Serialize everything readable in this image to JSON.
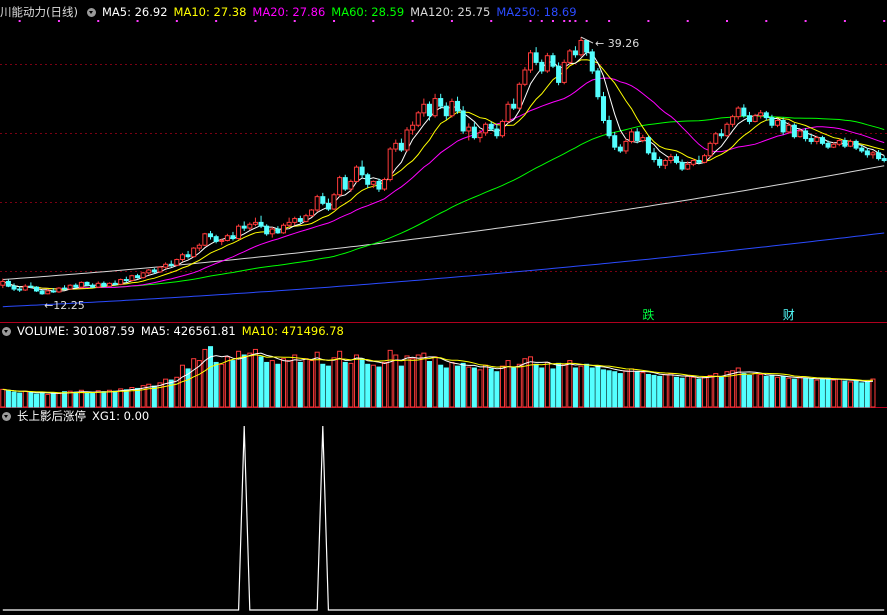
{
  "header_price": {
    "stock_name": "川能动力",
    "period": "(日线)",
    "items": [
      {
        "label": "MA5: 26.92",
        "color": "#ffffff"
      },
      {
        "label": "MA10: 27.38",
        "color": "#ffff00"
      },
      {
        "label": "MA20: 27.86",
        "color": "#ff00ff"
      },
      {
        "label": "MA60: 28.59",
        "color": "#00ff00"
      },
      {
        "label": "MA120: 25.75",
        "color": "#d8d8d8"
      },
      {
        "label": "MA250: 18.69",
        "color": "#2b4bff"
      }
    ]
  },
  "header_volume": {
    "items": [
      {
        "label": "VOLUME: 301087.59",
        "color": "#ffffff"
      },
      {
        "label": "MA5: 426561.81",
        "color": "#ffffff"
      },
      {
        "label": "MA10: 471496.78",
        "color": "#ffff00"
      }
    ]
  },
  "header_indicator": {
    "items": [
      {
        "label": "长上影后涨停",
        "color": "#ffffff"
      },
      {
        "label": "XG1: 0.00",
        "color": "#ffffff"
      }
    ]
  },
  "colors": {
    "up": "#ff3b3b",
    "down": "#54ffff",
    "divider": "#b0001e",
    "ma5": "#ffffff",
    "ma10": "#ffff00",
    "ma20": "#ff00ff",
    "ma60": "#00ff00",
    "ma120": "#d8d8d8",
    "ma250": "#2b4bff"
  },
  "chart_data": {
    "type": "candlestick",
    "y_range": [
      10.6,
      40.0
    ],
    "high_label": "39.26",
    "low_label": "12.25",
    "markers": [
      {
        "text": "跌",
        "index": 115
      },
      {
        "text": "财",
        "index": 140
      }
    ],
    "ohlc": [
      [
        13.2,
        13.9,
        12.9,
        13.6
      ],
      [
        13.6,
        13.8,
        13.0,
        13.1
      ],
      [
        13.1,
        13.4,
        12.6,
        12.8
      ],
      [
        12.8,
        13.1,
        12.5,
        12.7
      ],
      [
        12.7,
        13.3,
        12.6,
        13.1
      ],
      [
        13.1,
        13.5,
        12.9,
        13.0
      ],
      [
        13.0,
        13.1,
        12.5,
        12.6
      ],
      [
        12.6,
        12.7,
        12.2,
        12.3
      ],
      [
        12.3,
        12.8,
        12.25,
        12.6
      ],
      [
        12.6,
        12.9,
        12.4,
        12.5
      ],
      [
        12.5,
        13.0,
        12.4,
        12.9
      ],
      [
        12.9,
        13.2,
        12.7,
        12.8
      ],
      [
        12.8,
        13.3,
        12.7,
        13.2
      ],
      [
        13.2,
        13.4,
        12.9,
        13.0
      ],
      [
        13.0,
        13.6,
        12.9,
        13.5
      ],
      [
        13.5,
        13.6,
        13.1,
        13.2
      ],
      [
        13.2,
        13.4,
        12.9,
        13.0
      ],
      [
        13.0,
        13.6,
        12.9,
        13.4
      ],
      [
        13.4,
        13.6,
        13.0,
        13.1
      ],
      [
        13.1,
        13.5,
        13.0,
        13.4
      ],
      [
        13.4,
        13.7,
        13.2,
        13.3
      ],
      [
        13.3,
        13.9,
        13.2,
        13.8
      ],
      [
        13.8,
        14.1,
        13.5,
        13.7
      ],
      [
        13.7,
        14.3,
        13.6,
        14.2
      ],
      [
        14.2,
        14.4,
        13.9,
        14.0
      ],
      [
        14.0,
        14.6,
        13.9,
        14.5
      ],
      [
        14.5,
        14.9,
        14.3,
        14.8
      ],
      [
        14.8,
        15.0,
        14.4,
        14.6
      ],
      [
        14.6,
        15.2,
        14.5,
        15.1
      ],
      [
        15.1,
        15.6,
        14.9,
        15.4
      ],
      [
        15.4,
        15.8,
        15.1,
        15.3
      ],
      [
        15.3,
        16.0,
        15.2,
        15.9
      ],
      [
        15.9,
        16.6,
        15.7,
        16.4
      ],
      [
        16.4,
        16.8,
        16.0,
        16.2
      ],
      [
        16.2,
        17.2,
        16.1,
        17.1
      ],
      [
        17.1,
        17.6,
        16.8,
        17.4
      ],
      [
        17.4,
        18.7,
        17.3,
        18.6
      ],
      [
        18.6,
        18.9,
        18.0,
        18.3
      ],
      [
        18.3,
        18.5,
        17.6,
        17.8
      ],
      [
        17.8,
        18.1,
        17.4,
        17.9
      ],
      [
        17.9,
        18.6,
        17.8,
        18.4
      ],
      [
        18.4,
        18.8,
        17.9,
        18.1
      ],
      [
        18.1,
        19.6,
        18.0,
        19.4
      ],
      [
        19.4,
        19.9,
        18.9,
        19.2
      ],
      [
        19.2,
        19.8,
        19.0,
        19.6
      ],
      [
        19.6,
        20.3,
        19.4,
        19.8
      ],
      [
        19.8,
        20.5,
        19.2,
        19.4
      ],
      [
        19.4,
        19.6,
        18.4,
        18.6
      ],
      [
        18.6,
        19.3,
        18.2,
        19.1
      ],
      [
        19.1,
        19.4,
        18.6,
        18.7
      ],
      [
        18.7,
        19.7,
        18.6,
        19.5
      ],
      [
        19.5,
        20.3,
        19.3,
        19.8
      ],
      [
        19.8,
        20.4,
        19.5,
        20.2
      ],
      [
        20.2,
        20.5,
        19.7,
        19.9
      ],
      [
        19.9,
        20.7,
        19.8,
        20.5
      ],
      [
        20.5,
        21.2,
        20.4,
        21.1
      ],
      [
        21.1,
        22.7,
        20.9,
        22.5
      ],
      [
        22.5,
        22.9,
        21.6,
        21.8
      ],
      [
        21.8,
        22.3,
        21.0,
        21.2
      ],
      [
        21.2,
        22.9,
        21.1,
        22.7
      ],
      [
        22.7,
        24.7,
        22.5,
        24.5
      ],
      [
        24.5,
        24.8,
        23.1,
        23.3
      ],
      [
        23.3,
        24.3,
        23.0,
        24.1
      ],
      [
        24.1,
        25.8,
        24.0,
        25.6
      ],
      [
        25.6,
        26.3,
        24.5,
        24.8
      ],
      [
        24.8,
        25.0,
        23.4,
        23.8
      ],
      [
        23.8,
        24.2,
        23.4,
        24.1
      ],
      [
        24.1,
        24.4,
        23.0,
        23.3
      ],
      [
        23.3,
        24.5,
        23.1,
        24.3
      ],
      [
        24.3,
        27.7,
        24.1,
        27.5
      ],
      [
        27.5,
        28.5,
        27.2,
        28.1
      ],
      [
        28.1,
        28.6,
        27.2,
        27.4
      ],
      [
        27.4,
        29.8,
        27.2,
        29.5
      ],
      [
        29.5,
        30.4,
        29.0,
        30.0
      ],
      [
        30.0,
        31.5,
        29.8,
        31.3
      ],
      [
        31.3,
        32.8,
        30.9,
        32.2
      ],
      [
        32.2,
        32.5,
        30.5,
        31.0
      ],
      [
        31.0,
        33.3,
        30.8,
        32.8
      ],
      [
        32.8,
        33.3,
        31.7,
        32.0
      ],
      [
        32.0,
        32.4,
        30.6,
        31.0
      ],
      [
        31.0,
        32.8,
        30.8,
        32.5
      ],
      [
        32.5,
        33.0,
        31.2,
        31.5
      ],
      [
        31.5,
        32.0,
        29.1,
        29.4
      ],
      [
        29.4,
        30.2,
        28.4,
        29.8
      ],
      [
        29.8,
        30.3,
        28.5,
        28.7
      ],
      [
        28.7,
        29.5,
        28.2,
        29.2
      ],
      [
        29.2,
        30.3,
        28.9,
        30.1
      ],
      [
        30.1,
        30.4,
        29.4,
        29.6
      ],
      [
        29.6,
        30.1,
        28.6,
        28.9
      ],
      [
        28.9,
        30.6,
        28.7,
        30.4
      ],
      [
        30.4,
        32.5,
        30.2,
        32.2
      ],
      [
        32.2,
        32.8,
        31.6,
        31.8
      ],
      [
        31.8,
        34.5,
        31.6,
        34.3
      ],
      [
        34.3,
        36.1,
        34.1,
        35.8
      ],
      [
        35.8,
        37.9,
        35.5,
        37.6
      ],
      [
        37.6,
        38.2,
        36.3,
        36.6
      ],
      [
        36.6,
        36.9,
        35.4,
        35.7
      ],
      [
        35.7,
        37.6,
        35.5,
        37.3
      ],
      [
        37.3,
        37.6,
        36.0,
        36.2
      ],
      [
        36.2,
        36.6,
        34.2,
        34.5
      ],
      [
        34.5,
        36.9,
        34.3,
        36.6
      ],
      [
        36.6,
        38.0,
        36.4,
        37.8
      ],
      [
        37.8,
        38.3,
        37.1,
        37.4
      ],
      [
        37.4,
        39.26,
        37.2,
        38.9
      ],
      [
        38.9,
        39.0,
        37.3,
        37.7
      ],
      [
        37.7,
        38.0,
        35.4,
        35.7
      ],
      [
        35.7,
        36.0,
        32.7,
        33.0
      ],
      [
        33.0,
        33.5,
        30.2,
        30.5
      ],
      [
        30.5,
        31.0,
        28.6,
        28.9
      ],
      [
        28.9,
        29.3,
        27.4,
        27.7
      ],
      [
        27.7,
        28.0,
        27.1,
        27.3
      ],
      [
        27.3,
        28.6,
        27.0,
        28.3
      ],
      [
        28.3,
        29.6,
        28.1,
        29.3
      ],
      [
        29.3,
        29.7,
        28.1,
        28.4
      ],
      [
        28.4,
        29.0,
        28.2,
        28.7
      ],
      [
        28.7,
        28.9,
        26.9,
        27.1
      ],
      [
        27.1,
        27.6,
        26.1,
        26.4
      ],
      [
        26.4,
        26.7,
        25.5,
        25.8
      ],
      [
        25.8,
        26.5,
        25.4,
        26.3
      ],
      [
        26.3,
        27.0,
        26.0,
        26.7
      ],
      [
        26.7,
        27.0,
        25.9,
        26.1
      ],
      [
        26.1,
        26.4,
        25.2,
        25.4
      ],
      [
        25.4,
        26.2,
        25.3,
        25.9
      ],
      [
        25.9,
        26.5,
        25.7,
        26.3
      ],
      [
        26.3,
        26.8,
        25.9,
        26.1
      ],
      [
        26.1,
        27.0,
        26.0,
        26.8
      ],
      [
        26.8,
        28.3,
        26.6,
        28.1
      ],
      [
        28.1,
        29.3,
        27.9,
        29.1
      ],
      [
        29.1,
        29.6,
        28.6,
        28.9
      ],
      [
        28.9,
        30.3,
        28.8,
        30.1
      ],
      [
        30.1,
        31.1,
        29.8,
        30.9
      ],
      [
        30.9,
        32.0,
        30.6,
        31.8
      ],
      [
        31.8,
        32.2,
        30.8,
        31.0
      ],
      [
        31.0,
        31.4,
        30.1,
        30.4
      ],
      [
        30.4,
        31.2,
        30.3,
        31.0
      ],
      [
        31.0,
        31.6,
        30.7,
        31.3
      ],
      [
        31.3,
        31.5,
        30.5,
        30.8
      ],
      [
        30.8,
        31.1,
        29.7,
        30.0
      ],
      [
        30.0,
        30.7,
        29.8,
        30.5
      ],
      [
        30.5,
        30.8,
        29.0,
        29.3
      ],
      [
        29.3,
        30.3,
        29.1,
        30.0
      ],
      [
        30.0,
        30.2,
        28.6,
        28.8
      ],
      [
        28.8,
        29.6,
        28.7,
        29.4
      ],
      [
        29.4,
        29.7,
        28.3,
        28.6
      ],
      [
        28.6,
        29.1,
        28.0,
        28.3
      ],
      [
        28.3,
        28.9,
        28.0,
        28.7
      ],
      [
        28.7,
        28.9,
        27.9,
        28.1
      ],
      [
        28.1,
        28.4,
        27.5,
        27.7
      ],
      [
        27.7,
        28.2,
        27.6,
        28.0
      ],
      [
        28.0,
        28.6,
        27.8,
        28.4
      ],
      [
        28.4,
        28.7,
        27.6,
        27.8
      ],
      [
        27.8,
        28.5,
        27.7,
        28.3
      ],
      [
        28.3,
        28.5,
        27.4,
        27.6
      ],
      [
        27.6,
        27.9,
        27.1,
        27.3
      ],
      [
        27.3,
        27.6,
        26.6,
        26.9
      ],
      [
        26.9,
        27.3,
        26.5,
        27.1
      ],
      [
        27.1,
        27.4,
        26.3,
        26.5
      ],
      [
        26.5,
        26.8,
        26.1,
        26.3
      ]
    ],
    "ma120": {
      "start": 13.8,
      "end": 25.75
    },
    "ma250": {
      "start": 10.95,
      "end": 18.69
    },
    "volume": {
      "y_range": [
        0,
        700000
      ],
      "values": [
        190000,
        175000,
        160000,
        150000,
        170000,
        155000,
        140000,
        160000,
        135000,
        150000,
        145000,
        165000,
        170000,
        160000,
        180000,
        150000,
        145000,
        175000,
        165000,
        180000,
        170000,
        195000,
        185000,
        210000,
        200000,
        230000,
        245000,
        225000,
        260000,
        300000,
        290000,
        320000,
        450000,
        410000,
        520000,
        500000,
        620000,
        650000,
        480000,
        460000,
        540000,
        500000,
        600000,
        560000,
        580000,
        620000,
        540000,
        480000,
        500000,
        460000,
        520000,
        500000,
        560000,
        480000,
        520000,
        500000,
        590000,
        460000,
        440000,
        530000,
        600000,
        480000,
        470000,
        560000,
        520000,
        460000,
        450000,
        430000,
        480000,
        610000,
        560000,
        440000,
        550000,
        520000,
        560000,
        580000,
        490000,
        540000,
        450000,
        420000,
        480000,
        440000,
        470000,
        430000,
        420000,
        400000,
        450000,
        410000,
        380000,
        440000,
        500000,
        420000,
        460000,
        520000,
        540000,
        460000,
        420000,
        480000,
        410000,
        470000,
        460000,
        500000,
        420000,
        440000,
        460000,
        420000,
        440000,
        400000,
        390000,
        380000,
        360000,
        390000,
        410000,
        380000,
        370000,
        350000,
        340000,
        330000,
        350000,
        360000,
        320000,
        310000,
        330000,
        320000,
        300000,
        320000,
        340000,
        360000,
        330000,
        380000,
        390000,
        420000,
        360000,
        340000,
        360000,
        350000,
        330000,
        340000,
        320000,
        330000,
        310000,
        300000,
        320000,
        310000,
        300000,
        290000,
        300000,
        310000,
        290000,
        300000,
        280000,
        270000,
        290000,
        260000,
        270000,
        301087
      ]
    },
    "indicator": {
      "name": "XG1",
      "y_range": [
        0,
        1
      ],
      "signals": [
        43,
        57
      ]
    }
  }
}
